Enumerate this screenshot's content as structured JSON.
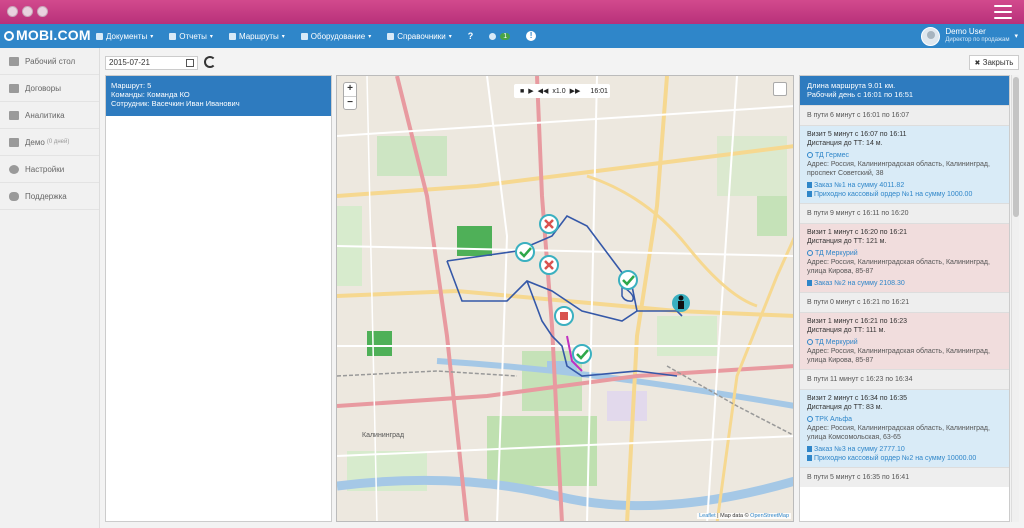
{
  "nav": {
    "brand": "MOBI.COM",
    "items": [
      {
        "label": "Документы",
        "icon": "document-icon",
        "caret": "▾"
      },
      {
        "label": "Отчеты",
        "icon": "chart-icon",
        "caret": "▾"
      },
      {
        "label": "Маршруты",
        "icon": "globe-icon",
        "caret": "▾"
      },
      {
        "label": "Оборудование",
        "icon": "device-icon",
        "caret": "▾"
      },
      {
        "label": "Справочники",
        "icon": "book-icon",
        "caret": "▾"
      }
    ],
    "help": "?",
    "users_badge": "1",
    "info": "!",
    "user_name": "Demo User",
    "user_role": "Директор по продажам"
  },
  "sidebar": {
    "items": [
      {
        "label": "Рабочий стол",
        "icon": "desktop-icon"
      },
      {
        "label": "Договоры",
        "icon": "file-icon"
      },
      {
        "label": "Аналитика",
        "icon": "analytics-icon"
      },
      {
        "label": "Демо",
        "sub": "(0 дней)",
        "icon": "bank-icon"
      },
      {
        "label": "Настройки",
        "icon": "gear-icon"
      },
      {
        "label": "Поддержка",
        "icon": "chat-icon"
      }
    ]
  },
  "toolbar": {
    "date": "2015-07-21",
    "close_label": "Закрыть",
    "close_icon": "✖"
  },
  "info": {
    "route": "Маршрут: 5",
    "team": "Команды: Команда КО",
    "employee": "Сотрудник: Васечкин Иван Иванович"
  },
  "map": {
    "zoom_in": "+",
    "zoom_out": "−",
    "player": {
      "speed": "x1.0",
      "time": "16:01"
    },
    "city": "Калининград",
    "attribution_leaflet": "Leaflet",
    "attribution_sep": " | Map data © ",
    "attribution_osm": "OpenStreetMap"
  },
  "events": {
    "summary_line1": "Длина маршрута 9.01 км.",
    "summary_line2": "Рабочий день с 16:01 по 16:51",
    "list": [
      {
        "type": "transit",
        "text": "В пути 6 минут с 16:01 по 16:07"
      },
      {
        "type": "visit",
        "status": "ok",
        "title": "Визит 5 минут с 16:07 по 16:11",
        "distance": "Дистанция до ТТ: 14 м.",
        "shop": "ТД Гермес",
        "address": "Адрес: Россия, Калининградская область, Калининград, проспект Советский, 38",
        "docs": [
          "Заказ №1 на сумму 4011.82",
          "Приходно кассовый ордер №1 на сумму 1000.00"
        ]
      },
      {
        "type": "transit",
        "text": "В пути 9 минут с 16:11 по 16:20"
      },
      {
        "type": "visit",
        "status": "bad",
        "title": "Визит 1 минут с 16:20 по 16:21",
        "distance": "Дистанция до ТТ: 121 м.",
        "shop": "ТД Меркурий",
        "address": "Адрес: Россия, Калининградская область, Калининград, улица Кирова, 85-87",
        "docs": [
          "Заказ №2 на сумму 2108.30"
        ]
      },
      {
        "type": "transit",
        "text": "В пути 0 минут с 16:21 по 16:21"
      },
      {
        "type": "visit",
        "status": "bad",
        "title": "Визит 1 минут с 16:21 по 16:23",
        "distance": "Дистанция до ТТ: 111 м.",
        "shop": "ТД Меркурий",
        "address": "Адрес: Россия, Калининградская область, Калининград, улица Кирова, 85-87",
        "docs": []
      },
      {
        "type": "transit",
        "text": "В пути 11 минут с 16:23 по 16:34"
      },
      {
        "type": "visit",
        "status": "ok",
        "title": "Визит 2 минут с 16:34 по 16:35",
        "distance": "Дистанция до ТТ: 83 м.",
        "shop": "ТРК Альфа",
        "address": "Адрес: Россия, Калининградская область, Калининград, улица Комсомольская, 63-65",
        "docs": [
          "Заказ №3 на сумму 2777.10",
          "Приходно кассовый ордер №2 на сумму 10000.00"
        ]
      },
      {
        "type": "transit",
        "text": "В пути 5 минут с 16:35 по 16:41"
      }
    ]
  },
  "colors": {
    "accent": "#2f86c9",
    "titlebar": "#c03c82",
    "visit_ok": "#d9ebf7",
    "visit_bad": "#f1dddd"
  }
}
